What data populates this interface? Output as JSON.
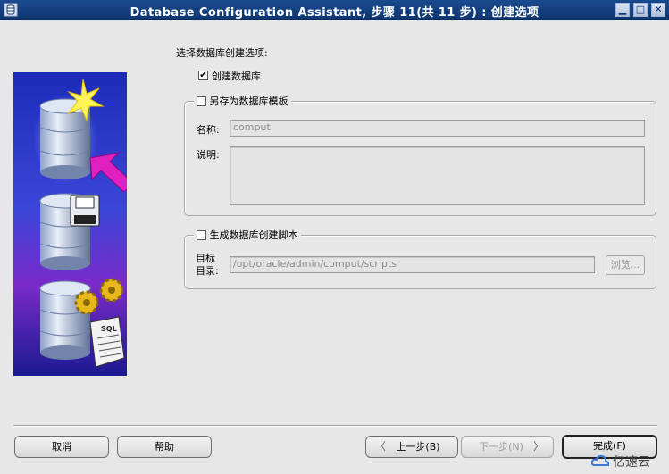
{
  "window": {
    "title": "Database Configuration Assistant, 步骤 11(共 11 步) : 创建选项",
    "min_glyph": "▁",
    "max_glyph": "□",
    "close_glyph": "✕"
  },
  "illustration": {
    "icons": [
      "database-star-icon",
      "database-floppy-icon",
      "database-gears-sql-icon",
      "magenta-arrow-icon"
    ],
    "sql_label": "SQL"
  },
  "options": {
    "heading": "选择数据库创建选项:",
    "create_database": {
      "label": "创建数据库",
      "checked": true,
      "mark": "✔"
    },
    "save_template": {
      "label": "另存为数据库模板",
      "checked": false,
      "name_label": "名称:",
      "name_value": "comput",
      "desc_label": "说明:",
      "desc_value": ""
    },
    "gen_scripts": {
      "label": "生成数据库创建脚本",
      "checked": false,
      "dest_label_line1": "目标",
      "dest_label_line2": "目录:",
      "dest_value": "/opt/oracle/admin/comput/scripts",
      "browse_label": "浏览..."
    }
  },
  "footer": {
    "cancel": "取消",
    "help": "帮助",
    "back": "上一步(B)",
    "next": "下一步(N)",
    "finish": "完成(F)",
    "back_arrow": "〈",
    "next_arrow": "〉"
  },
  "watermark": {
    "text": "亿速云"
  },
  "colors": {
    "titlebar": "#1a4b8f",
    "dialog_bg": "#e7e7e7",
    "illustration_bg": "#2a2aa8",
    "arrow": "#e020c0"
  }
}
